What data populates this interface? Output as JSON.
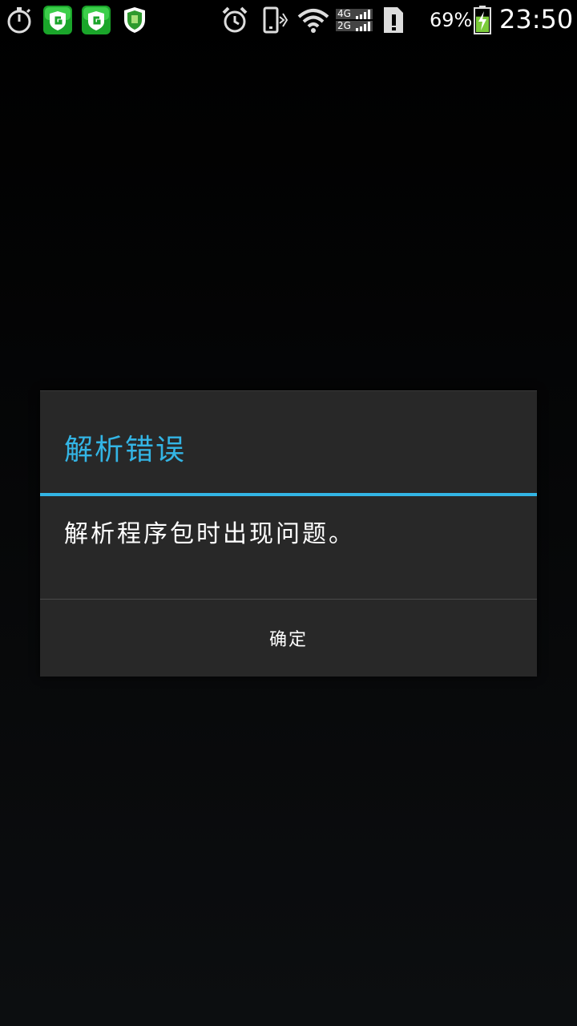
{
  "status_bar": {
    "icons_left": [
      "stopwatch-icon",
      "app-shield-icon",
      "app-shield-icon",
      "security-shield-icon"
    ],
    "icons_right": [
      "alarm-icon",
      "vibrate-icon",
      "wifi-icon",
      "signal-4g-2g-icon",
      "sim-alert-icon",
      "battery-charging-icon"
    ],
    "network_top": "4G",
    "network_bottom": "2G",
    "battery_percent": "69%",
    "battery_level": 0.69,
    "time": "23:50"
  },
  "dialog": {
    "title": "解析错误",
    "message": "解析程序包时出现问题。",
    "ok_label": "确定"
  },
  "colors": {
    "accent": "#33b5e5",
    "dialog_bg": "#282828",
    "app_icon_green": "#1aa52a",
    "battery_green": "#7ccc3a"
  }
}
